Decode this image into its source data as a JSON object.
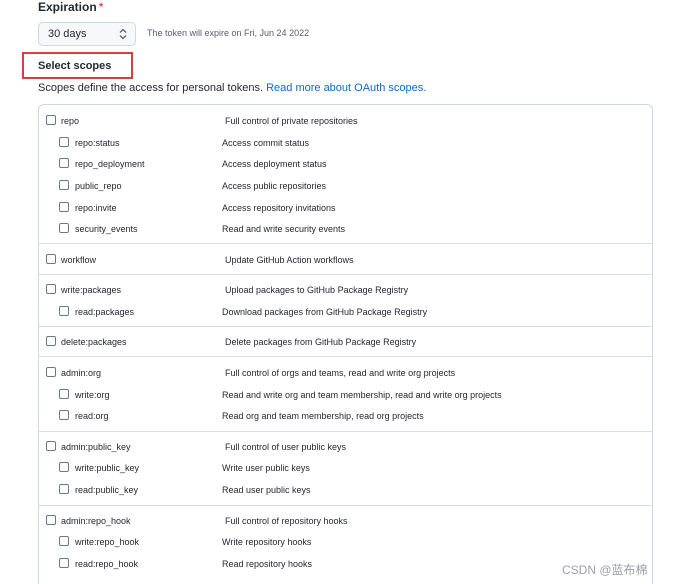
{
  "expiration": {
    "label": "Expiration",
    "required_mark": "*",
    "selected": "30 days",
    "note": "The token will expire on Fri, Jun 24 2022"
  },
  "scopes": {
    "title": "Select scopes",
    "description": "Scopes define the access for personal tokens.",
    "link": "Read more about OAuth scopes.",
    "rows": [
      {
        "name": "repo",
        "desc": "Full control of private repositories"
      },
      {
        "name": "repo:status",
        "desc": "Access commit status"
      },
      {
        "name": "repo_deployment",
        "desc": "Access deployment status"
      },
      {
        "name": "public_repo",
        "desc": "Access public repositories"
      },
      {
        "name": "repo:invite",
        "desc": "Access repository invitations"
      },
      {
        "name": "security_events",
        "desc": "Read and write security events"
      },
      {
        "name": "workflow",
        "desc": "Update GitHub Action workflows"
      },
      {
        "name": "write:packages",
        "desc": "Upload packages to GitHub Package Registry"
      },
      {
        "name": "read:packages",
        "desc": "Download packages from GitHub Package Registry"
      },
      {
        "name": "delete:packages",
        "desc": "Delete packages from GitHub Package Registry"
      },
      {
        "name": "admin:org",
        "desc": "Full control of orgs and teams, read and write org projects"
      },
      {
        "name": "write:org",
        "desc": "Read and write org and team membership, read and write org projects"
      },
      {
        "name": "read:org",
        "desc": "Read org and team membership, read org projects"
      },
      {
        "name": "admin:public_key",
        "desc": "Full control of user public keys"
      },
      {
        "name": "write:public_key",
        "desc": "Write user public keys"
      },
      {
        "name": "read:public_key",
        "desc": "Read user public keys"
      },
      {
        "name": "admin:repo_hook",
        "desc": "Full control of repository hooks"
      },
      {
        "name": "write:repo_hook",
        "desc": "Write repository hooks"
      },
      {
        "name": "read:repo_hook",
        "desc": "Read repository hooks"
      }
    ]
  },
  "watermark": "CSDN @蓝布棉",
  "colors": {
    "link": "#0969da",
    "highlight_box": "#e23a3a",
    "required": "#cf222e"
  }
}
